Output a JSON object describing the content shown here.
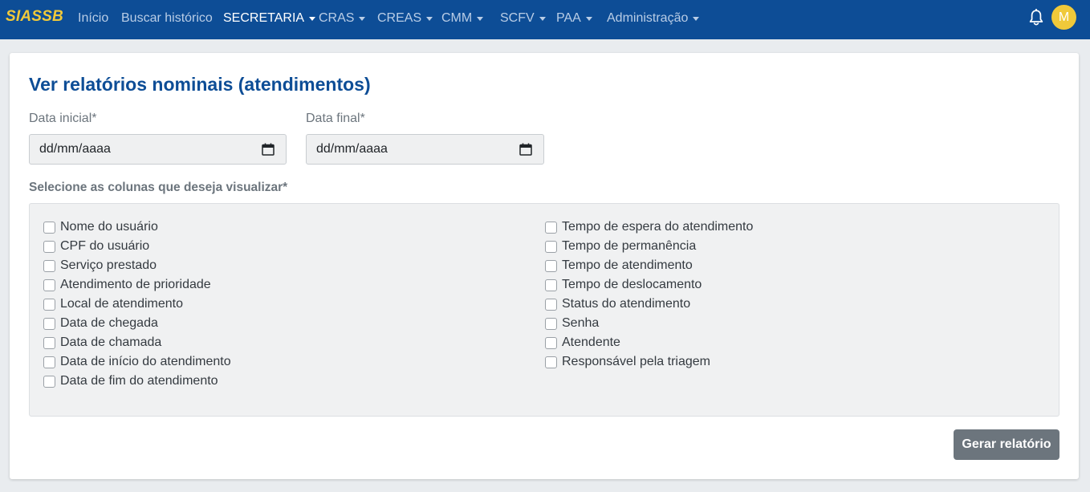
{
  "navbar": {
    "brand": "SIASSB",
    "items": [
      {
        "label": "Início"
      },
      {
        "label": "Buscar histórico"
      },
      {
        "label": "SECRETARIA"
      },
      {
        "label": "CRAS"
      },
      {
        "label": "CREAS"
      },
      {
        "label": "CMM"
      },
      {
        "label": "SCFV"
      },
      {
        "label": "PAA"
      },
      {
        "label": "Administração"
      }
    ],
    "active_item": "SECRETARIA",
    "notification_icon": "bell-icon",
    "avatar_initial": "M"
  },
  "page": {
    "title": "Ver relatórios nominais (atendimentos)"
  },
  "form": {
    "start_date": {
      "label": "Data inicial*",
      "placeholder": "dd/mm/aaaa"
    },
    "end_date": {
      "label": "Data final*",
      "placeholder": "dd/mm/aaaa"
    },
    "columns_label": "Selecione as colunas que deseja visualizar*",
    "columns_left": [
      {
        "label": "Nome do usuário",
        "checked": false
      },
      {
        "label": "CPF do usuário",
        "checked": false
      },
      {
        "label": "Serviço prestado",
        "checked": false
      },
      {
        "label": "Atendimento de prioridade",
        "checked": false
      },
      {
        "label": "Local de atendimento",
        "checked": false
      },
      {
        "label": "Data de chegada",
        "checked": false
      },
      {
        "label": "Data de chamada",
        "checked": false
      },
      {
        "label": "Data de início do atendimento",
        "checked": false
      },
      {
        "label": "Data de fim do atendimento",
        "checked": false
      }
    ],
    "columns_right": [
      {
        "label": "Tempo de espera do atendimento",
        "checked": false
      },
      {
        "label": "Tempo de permanência",
        "checked": false
      },
      {
        "label": "Tempo de atendimento",
        "checked": false
      },
      {
        "label": "Tempo de deslocamento",
        "checked": false
      },
      {
        "label": "Status do atendimento",
        "checked": false
      },
      {
        "label": "Senha",
        "checked": false
      },
      {
        "label": "Atendente",
        "checked": false
      },
      {
        "label": "Responsável pela triagem",
        "checked": false
      }
    ],
    "submit_label": "Gerar relatório"
  },
  "colors": {
    "navbar": "#0d4d96",
    "brand": "#f0c93a",
    "title": "#0d4d96",
    "button": "#6c757d"
  }
}
